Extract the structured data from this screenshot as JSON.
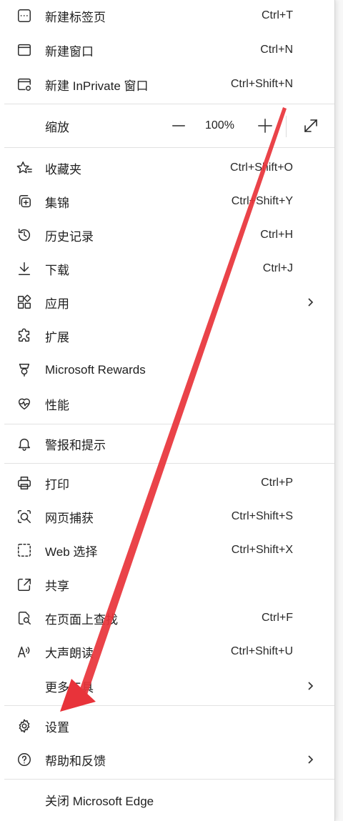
{
  "menu": {
    "items_top": [
      {
        "label": "新建标签页",
        "shortcut": "Ctrl+T",
        "icon": "new-tab-icon"
      },
      {
        "label": "新建窗口",
        "shortcut": "Ctrl+N",
        "icon": "new-window-icon"
      },
      {
        "label": "新建 InPrivate 窗口",
        "shortcut": "Ctrl+Shift+N",
        "icon": "inprivate-window-icon"
      }
    ],
    "zoom": {
      "label": "缩放",
      "value": "100%"
    },
    "items_mid": [
      {
        "label": "收藏夹",
        "shortcut": "Ctrl+Shift+O",
        "icon": "favorites-icon"
      },
      {
        "label": "集锦",
        "shortcut": "Ctrl+Shift+Y",
        "icon": "collections-icon"
      },
      {
        "label": "历史记录",
        "shortcut": "Ctrl+H",
        "icon": "history-icon"
      },
      {
        "label": "下载",
        "shortcut": "Ctrl+J",
        "icon": "download-icon"
      },
      {
        "label": "应用",
        "shortcut": "",
        "icon": "apps-icon"
      },
      {
        "label": "扩展",
        "shortcut": "",
        "icon": "extensions-icon"
      },
      {
        "label": "Microsoft Rewards",
        "shortcut": "",
        "icon": "rewards-icon"
      },
      {
        "label": "性能",
        "shortcut": "",
        "icon": "performance-icon"
      }
    ],
    "alerts": {
      "label": "警报和提示",
      "icon": "bell-icon"
    },
    "items_tools": [
      {
        "label": "打印",
        "shortcut": "Ctrl+P",
        "icon": "print-icon"
      },
      {
        "label": "网页捕获",
        "shortcut": "Ctrl+Shift+S",
        "icon": "web-capture-icon"
      },
      {
        "label": "Web 选择",
        "shortcut": "Ctrl+Shift+X",
        "icon": "web-select-icon"
      },
      {
        "label": "共享",
        "shortcut": "",
        "icon": "share-icon"
      },
      {
        "label": "在页面上查找",
        "shortcut": "Ctrl+F",
        "icon": "find-icon"
      },
      {
        "label": "大声朗读",
        "shortcut": "Ctrl+Shift+U",
        "icon": "read-aloud-icon"
      },
      {
        "label": "更多工具",
        "shortcut": "",
        "icon": ""
      }
    ],
    "settings": {
      "label": "设置",
      "icon": "gear-icon"
    },
    "help": {
      "label": "帮助和反馈",
      "icon": "help-icon"
    },
    "close": {
      "label": "关闭 Microsoft Edge"
    }
  },
  "colors": {
    "annotation_arrow": "#e8333a",
    "menu_bg": "#ffffff",
    "separator": "#e2e2e2"
  }
}
